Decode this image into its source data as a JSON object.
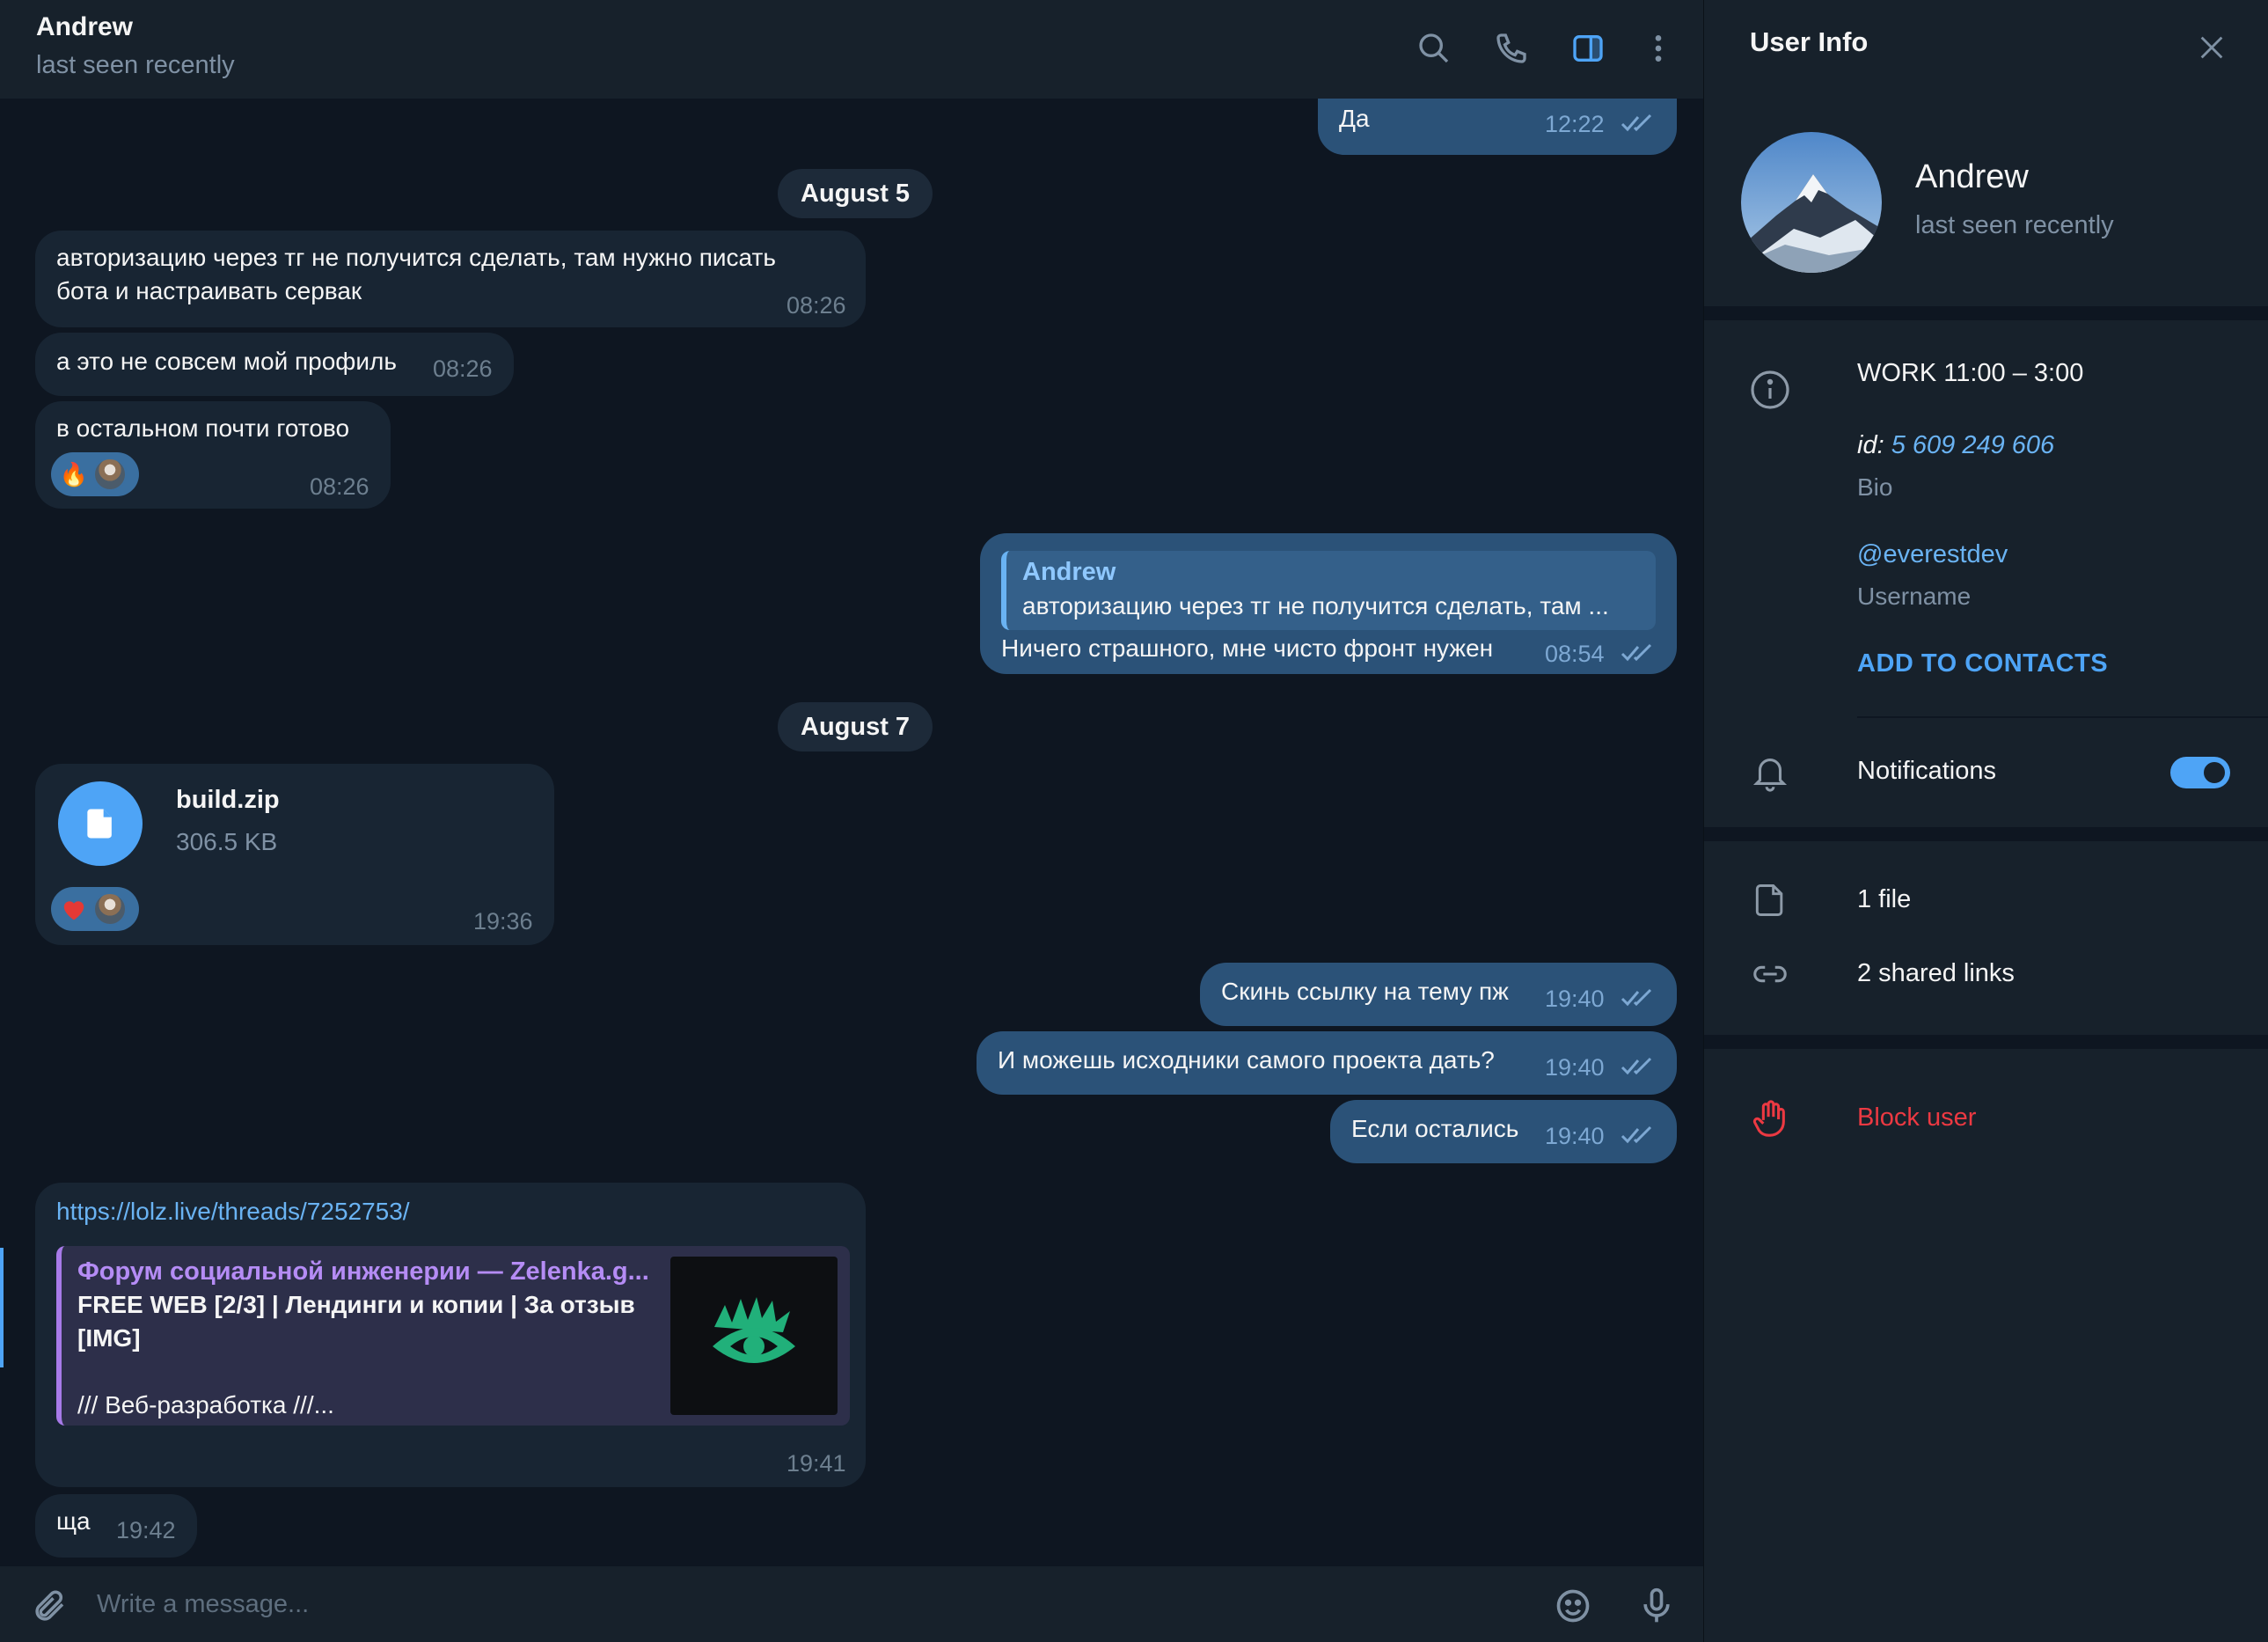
{
  "header": {
    "name": "Andrew",
    "status": "last seen recently",
    "icons": [
      "search-icon",
      "phone-icon",
      "sidebar-toggle-icon",
      "more-vertical-icon"
    ]
  },
  "dates": {
    "d1": "August 5",
    "d2": "August 7"
  },
  "messages": {
    "m0": {
      "text": "Да",
      "time": "12:22"
    },
    "m1": {
      "line1": "авторизацию через тг не получится сделать, там нужно писать",
      "line2": "бота и настраивать сервак",
      "time": "08:26"
    },
    "m2": {
      "text": "а это не совсем мой профиль",
      "time": "08:26"
    },
    "m3": {
      "text": "в остальном почти готово",
      "time": "08:26",
      "reaction": "🔥"
    },
    "m4": {
      "reply_name": "Andrew",
      "reply_text": "авторизацию через тг не получится сделать, там ...",
      "text": "Ничего страшного, мне чисто фронт нужен",
      "time": "08:54"
    },
    "m5": {
      "file_name": "build.zip",
      "file_size": "306.5 KB",
      "time": "19:36",
      "reaction": "❤️"
    },
    "m6": {
      "text": "Скинь ссылку на тему пж",
      "time": "19:40"
    },
    "m7": {
      "text": "И можешь исходники самого проекта дать?",
      "time": "19:40"
    },
    "m8": {
      "text": "Если остались",
      "time": "19:40"
    },
    "m9": {
      "url": "https://lolz.live/threads/7252753/",
      "site": "Форум социальной инженерии — Zelenka.g...",
      "title": "FREE WEB [2/3] | Лендинги и копии | За отзыв [IMG]",
      "desc": "/// Веб-разработка ///...",
      "time": "19:41"
    },
    "m10": {
      "text": "ща",
      "time": "19:42"
    }
  },
  "composer": {
    "placeholder": "Write a message..."
  },
  "info_panel": {
    "title": "User Info",
    "name": "Andrew",
    "status": "last seen recently",
    "bio": "WORK 11:00 – 3:00",
    "id_label": "id:",
    "id_value": "5 609 249 606",
    "bio_label": "Bio",
    "username": "@everestdev",
    "username_label": "Username",
    "add_contacts": "ADD TO CONTACTS",
    "notifications": "Notifications",
    "notifications_enabled": true,
    "files": "1 file",
    "links": "2 shared links",
    "block": "Block user"
  },
  "colors": {
    "background": "#0e1621",
    "panel": "#17212b",
    "incoming_bubble": "#182533",
    "outgoing_bubble": "#2b5278",
    "accent": "#4ea4f6",
    "danger": "#ec3942"
  }
}
